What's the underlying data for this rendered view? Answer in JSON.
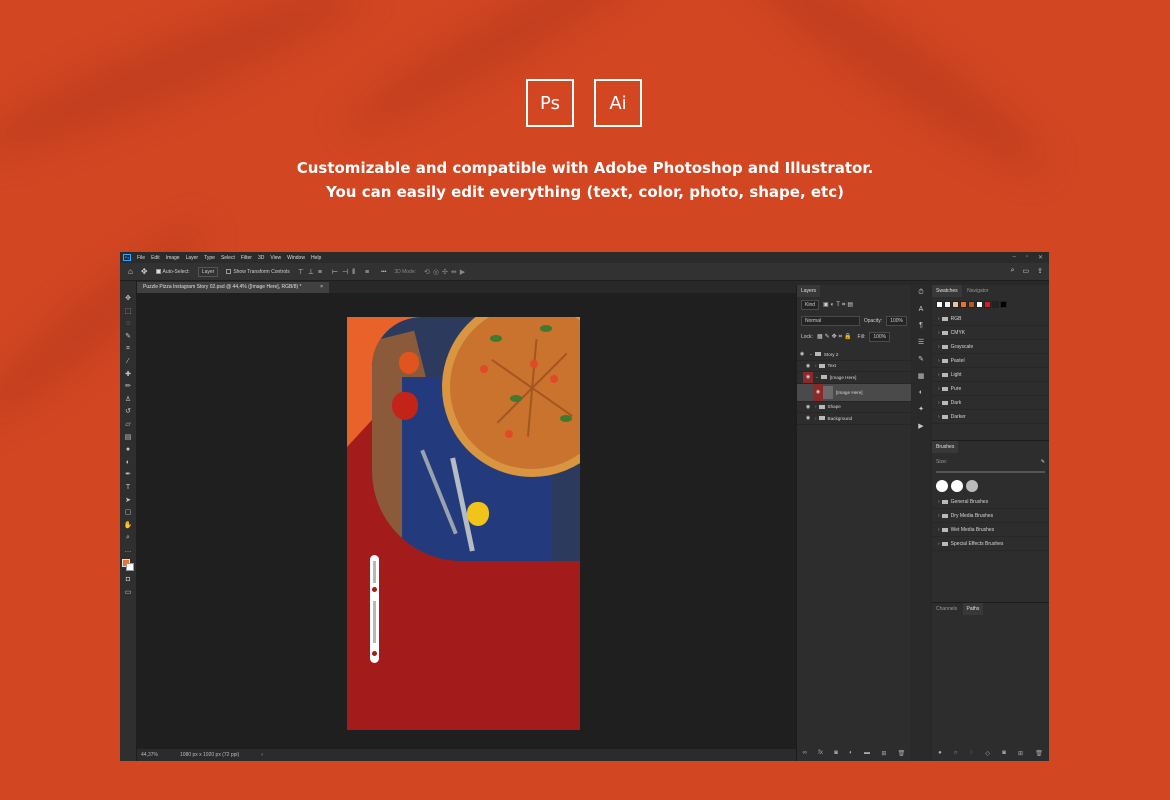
{
  "badges": {
    "ps": "Ps",
    "ai": "Ai"
  },
  "tagline": {
    "line1": "Customizable and compatible with Adobe Photoshop and Illustrator.",
    "line2": "You can easily edit everything (text, color, photo, shape, etc)"
  },
  "menu": [
    "File",
    "Edit",
    "Image",
    "Layer",
    "Type",
    "Select",
    "Filter",
    "3D",
    "View",
    "Window",
    "Help"
  ],
  "options": {
    "auto_select": "Auto-Select:",
    "layer": "Layer",
    "transform": "Show Transform Controls",
    "mode3d": "3D Mode:"
  },
  "document": {
    "tab": "Puzzle Pizza Instagram Story 02.psd @ 44,4% ([Image Here], RGB/8) *",
    "zoom": "44,37%",
    "size": "1080 px x 1920 px (72 ppi)"
  },
  "layers": {
    "tab": "Layers",
    "kind": "Kind",
    "blend": "Normal",
    "opacity_label": "Opacity:",
    "opacity": "100%",
    "lock_label": "Lock:",
    "fill_label": "Fill:",
    "fill": "100%",
    "rows": [
      {
        "name": "Story 2"
      },
      {
        "name": "Text"
      },
      {
        "name": "[Image Here]"
      },
      {
        "name": "[Image Here]"
      },
      {
        "name": "Shape"
      },
      {
        "name": "Background"
      }
    ]
  },
  "swatches": {
    "tab": "Swatches",
    "tab2": "Navigator",
    "colors": [
      "#ffffff",
      "#f1f1f1",
      "#e8c2a2",
      "#e8732f",
      "#b25a28",
      "#ffffff",
      "#d91b1b",
      "#222222",
      "#000000"
    ],
    "groups": [
      "RGB",
      "CMYK",
      "Grayscale",
      "Pastel",
      "Light",
      "Pure",
      "Dark",
      "Darker"
    ]
  },
  "brushes": {
    "tab": "Brushes",
    "size_label": "Size:",
    "groups": [
      "General Brushes",
      "Dry Media Brushes",
      "Wet Media Brushes",
      "Special Effects Brushes"
    ]
  },
  "paths": {
    "tab1": "Channels",
    "tab2": "Paths"
  }
}
